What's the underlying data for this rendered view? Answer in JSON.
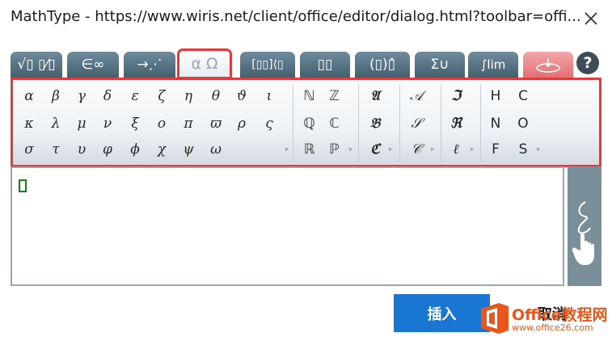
{
  "window": {
    "title": "MathType - https://www.wiris.net/client/office/editor/dialog.html?toolbar=offi..."
  },
  "tabs": [
    {
      "label": "√▯ ▯⁄▯",
      "icon": "general-tab-icon"
    },
    {
      "label": "∈∞",
      "icon": "symbols-tab-icon"
    },
    {
      "label": "→⋰",
      "icon": "arrows-tab-icon"
    },
    {
      "label": "α Ω",
      "icon": "greek-tab-icon",
      "selected": true
    },
    {
      "label": "[▯▯]⟨▯",
      "icon": "matrices-tab-icon"
    },
    {
      "label": "▯▯",
      "icon": "scripts-tab-icon"
    },
    {
      "label": "(▯)▯̂",
      "icon": "brackets-tab-icon"
    },
    {
      "label": "Σ∪",
      "icon": "bigops-tab-icon"
    },
    {
      "label": "∫lim",
      "icon": "calculus-tab-icon"
    },
    {
      "label": "",
      "icon": "contextual-tab-icon"
    }
  ],
  "help": {
    "label": "?"
  },
  "palette": {
    "greek": [
      [
        "α",
        "β",
        "γ",
        "δ",
        "ε",
        "ζ",
        "η",
        "θ",
        "ϑ",
        "ι"
      ],
      [
        "κ",
        "λ",
        "μ",
        "ν",
        "ξ",
        "ο",
        "π",
        "ϖ",
        "ρ",
        "ς"
      ],
      [
        "σ",
        "τ",
        "υ",
        "φ",
        "ϕ",
        "χ",
        "ψ",
        "ω"
      ]
    ],
    "doublestruck": [
      [
        "ℕ",
        "ℤ"
      ],
      [
        "ℚ",
        "ℂ"
      ],
      [
        "ℝ",
        "ℙ"
      ]
    ],
    "fraktur": [
      "𝔄",
      "𝔅",
      "ℭ"
    ],
    "script": [
      "𝒜",
      "𝒮",
      "𝒞"
    ],
    "fraktur2": [
      "ℑ",
      "ℜ",
      "ℓ"
    ],
    "latin": [
      [
        "H",
        "C"
      ],
      [
        "N",
        "O"
      ],
      [
        "F",
        "S"
      ]
    ]
  },
  "buttons": {
    "insert": "插入",
    "cancel": "取消"
  },
  "watermark": {
    "name": "Office教程网",
    "url": "www.office26.com"
  },
  "colors": {
    "accent": "#1976d2",
    "highlight": "#e33a3d",
    "tab": "#4f6b7a"
  }
}
